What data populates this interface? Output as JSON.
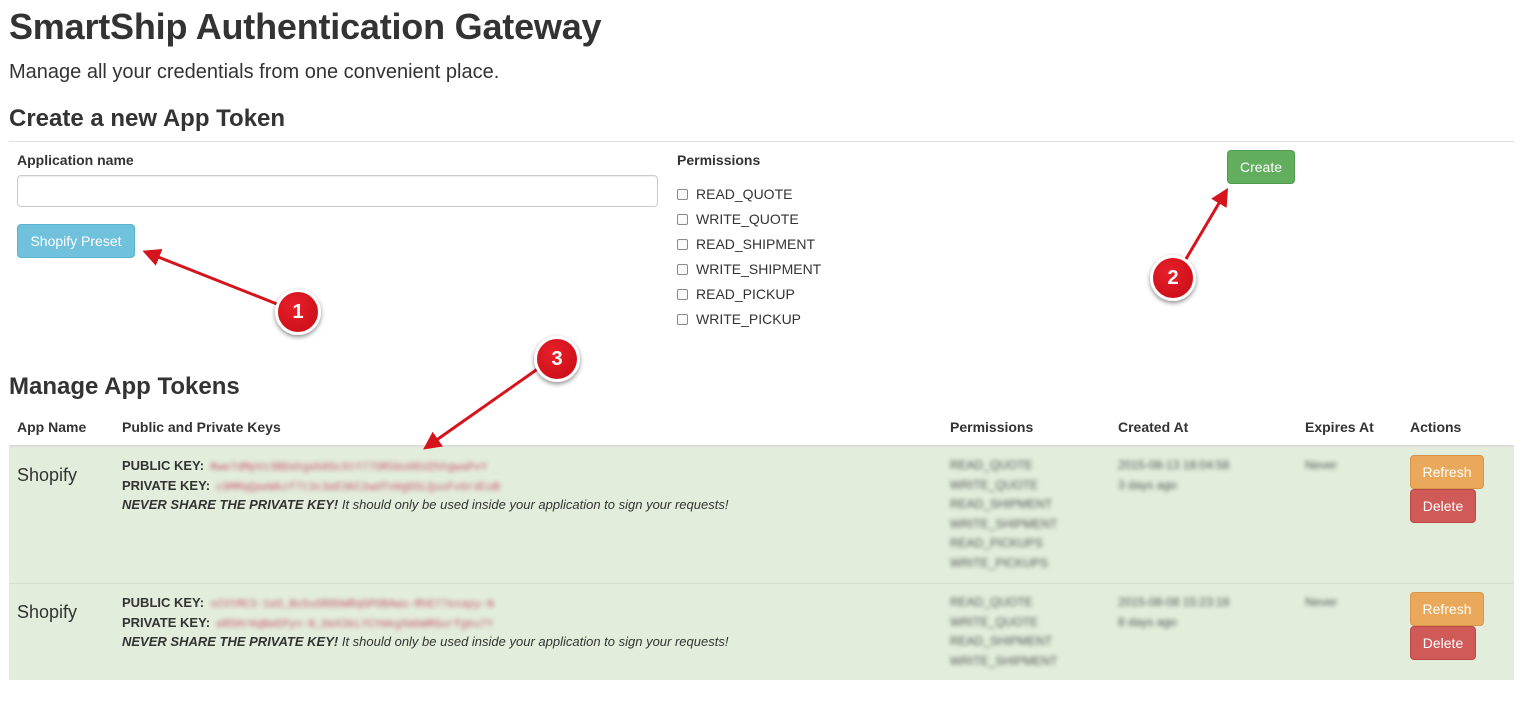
{
  "header": {
    "title": "SmartShip Authentication Gateway",
    "subtitle": "Manage all your credentials from one convenient place."
  },
  "create_section": {
    "heading": "Create a new App Token",
    "app_name_label": "Application name",
    "app_name_value": "",
    "app_name_placeholder": "",
    "shopify_preset_label": "Shopify Preset",
    "permissions_label": "Permissions",
    "permissions": [
      "READ_QUOTE",
      "WRITE_QUOTE",
      "READ_SHIPMENT",
      "WRITE_SHIPMENT",
      "READ_PICKUP",
      "WRITE_PICKUP"
    ],
    "create_label": "Create"
  },
  "manage_section": {
    "heading": "Manage App Tokens",
    "columns": [
      "App Name",
      "Public and Private Keys",
      "Permissions",
      "Created At",
      "Expires At",
      "Actions"
    ],
    "public_key_label": "PUBLIC KEY:",
    "private_key_label": "PRIVATE KEY:",
    "warning_bold": "NEVER SHARE THE PRIVATE KEY!",
    "warning_rest": " It should only be used inside your application to sign your requests!",
    "refresh_label": "Refresh",
    "delete_label": "Delete",
    "rows": [
      {
        "app_name": "Shopify",
        "public_key": "Rwe7dMpVz3BDahgeb8ScXtY77OR5bo6EUZhhgwaPvY",
        "private_key": "c9MMqQaeWkzf7t3c3eE3KC2wdfnHgDSLQuuFvGrdCuB",
        "permissions": [
          "READ_QUOTE",
          "WRITE_QUOTE",
          "READ_SHIPMENT",
          "WRITE_SHIPMENT",
          "READ_PICKUPS",
          "WRITE_PICKUPS"
        ],
        "created_at": "2015-08-13 18:04:58",
        "created_ago": "3 days ago",
        "expires_at": "Never"
      },
      {
        "app_name": "Shopify",
        "public_key": "sCVtMC3-1eO_Bu5uSR8bWRqSPOBAwu-RhE77exapy-N",
        "private_key": "eR5HrHqBeEPyn-N_OeX3kLYCYmkgXmbWRGurfgku7Y",
        "permissions": [
          "READ_QUOTE",
          "WRITE_QUOTE",
          "READ_SHIPMENT",
          "WRITE_SHIPMENT"
        ],
        "created_at": "2015-08-08 15:23:18",
        "created_ago": "8 days ago",
        "expires_at": "Never"
      }
    ]
  },
  "annotations": {
    "markers": [
      "1",
      "2",
      "3"
    ],
    "color": "#d6141c"
  }
}
